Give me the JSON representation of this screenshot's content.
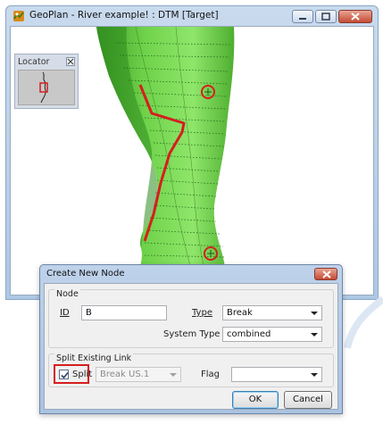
{
  "window": {
    "title": "GeoPlan - River example! : DTM  [Target]"
  },
  "locator": {
    "title": "Locator"
  },
  "dialog": {
    "title": "Create New Node",
    "node_group": {
      "label": "Node",
      "id_label": "ID",
      "id_value": "B",
      "type_label": "Type",
      "type_value": "Break",
      "system_type_label": "System Type",
      "system_type_value": "combined"
    },
    "split_group": {
      "label": "Split Existing Link",
      "split_label": "Split",
      "split_checked": true,
      "link_value": "Break US.1",
      "flag_label": "Flag",
      "flag_value": ""
    },
    "buttons": {
      "ok": "OK",
      "cancel": "Cancel"
    }
  },
  "colors": {
    "terrain_dark": "#2d8a1e",
    "terrain_light": "#7ee05a",
    "highlight_red": "#d61e1e",
    "titlebar": "#bfd3ea"
  },
  "icons": {
    "app": "geoplan-app-icon",
    "minimize": "minimize-icon",
    "maximize": "maximize-icon",
    "close": "close-icon"
  }
}
